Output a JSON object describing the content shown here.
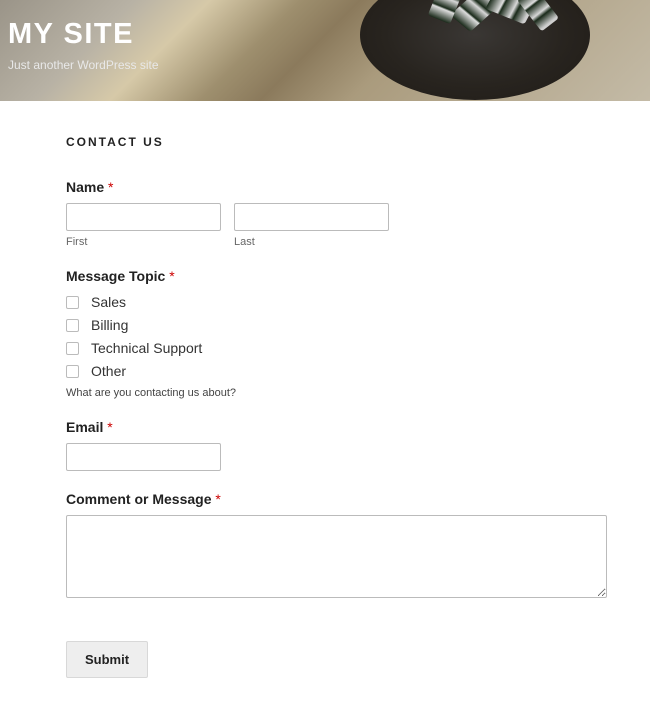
{
  "header": {
    "site_title": "MY SITE",
    "tagline": "Just another WordPress site"
  },
  "page": {
    "title": "CONTACT US"
  },
  "form": {
    "name": {
      "label": "Name",
      "required_marker": "*",
      "first_sublabel": "First",
      "last_sublabel": "Last",
      "first_value": "",
      "last_value": ""
    },
    "topic": {
      "label": "Message Topic",
      "required_marker": "*",
      "options": [
        "Sales",
        "Billing",
        "Technical Support",
        "Other"
      ],
      "helper": "What are you contacting us about?"
    },
    "email": {
      "label": "Email",
      "required_marker": "*",
      "value": ""
    },
    "comment": {
      "label": "Comment or Message",
      "required_marker": "*",
      "value": ""
    },
    "submit_label": "Submit"
  }
}
